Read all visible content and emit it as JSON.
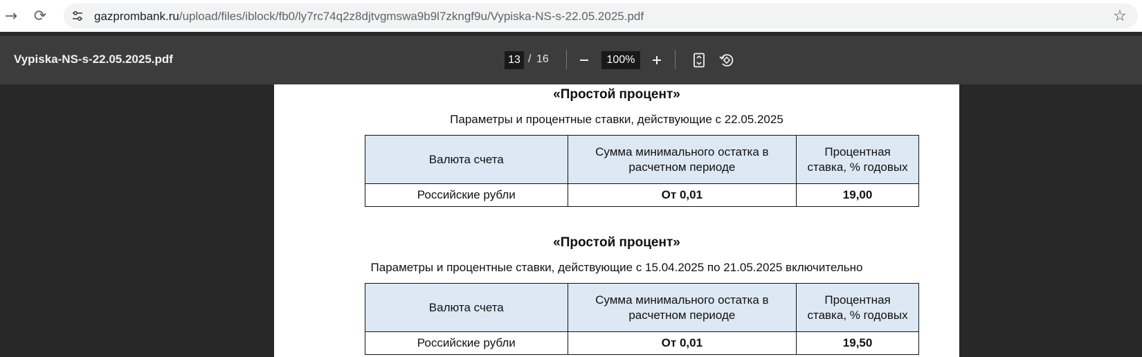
{
  "browser": {
    "url_host": "gazprombank.ru",
    "url_path": "/upload/files/iblock/fb0/ly7rc74q2z8djtvgmswa9b9l7zkngf9u/Vypiska-NS-s-22.05.2025.pdf",
    "icons": [
      "forward-icon",
      "reload-icon",
      "site-info-icon",
      "bookmark-star-icon"
    ]
  },
  "toolbar": {
    "title": "Vypiska-NS-s-22.05.2025.pdf",
    "page_current": "13",
    "page_separator": "/",
    "page_total": "16",
    "zoom": "100%",
    "icons": [
      "zoom-out-icon",
      "zoom-in-icon",
      "fit-page-icon",
      "rotate-icon"
    ]
  },
  "sections": [
    {
      "title": "«Простой процент»",
      "subtitle": "Параметры и процентные ставки, действующие с 22.05.2025",
      "headers": [
        "Валюта счета",
        "Сумма минимального остатка в расчетном периоде",
        "Процентная ставка, % годовых"
      ],
      "row": [
        "Российские рубли",
        "От 0,01",
        "19,00"
      ]
    },
    {
      "title": "«Простой процент»",
      "subtitle": "Параметры и процентные ставки, действующие с 15.04.2025 по 21.05.2025 включительно",
      "headers": [
        "Валюта счета",
        "Сумма минимального остатка в расчетном периоде",
        "Процентная ставка, % годовых"
      ],
      "row": [
        "Российские рубли",
        "От 0,01",
        "19,50"
      ]
    }
  ]
}
